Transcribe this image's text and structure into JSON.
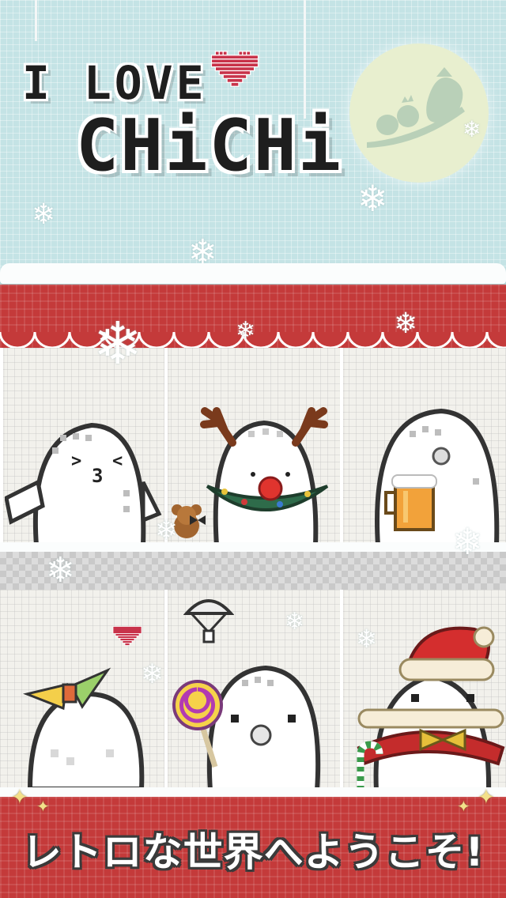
{
  "title": {
    "line1": "I LOVE",
    "line2": "CHiCHi"
  },
  "tagline": "レトロな世界へようこそ!",
  "colors": {
    "sky": "#c4e3e5",
    "red_band": "#c43a3a",
    "shelf": "#f2f1ec",
    "moon": "#e8efcf",
    "snow": "#ffffff",
    "title_text": "#1e1e1e"
  },
  "icons": {
    "heart": "pixel-heart-icon",
    "snowflake": "snowflake-icon",
    "sparkle": "sparkle-icon"
  },
  "characters": [
    {
      "id": "kissing-chichi"
    },
    {
      "id": "reindeer-chichi"
    },
    {
      "id": "beer-chichi"
    },
    {
      "id": "bow-chichi"
    },
    {
      "id": "lollipop-chichi"
    },
    {
      "id": "santa-chichi"
    }
  ]
}
